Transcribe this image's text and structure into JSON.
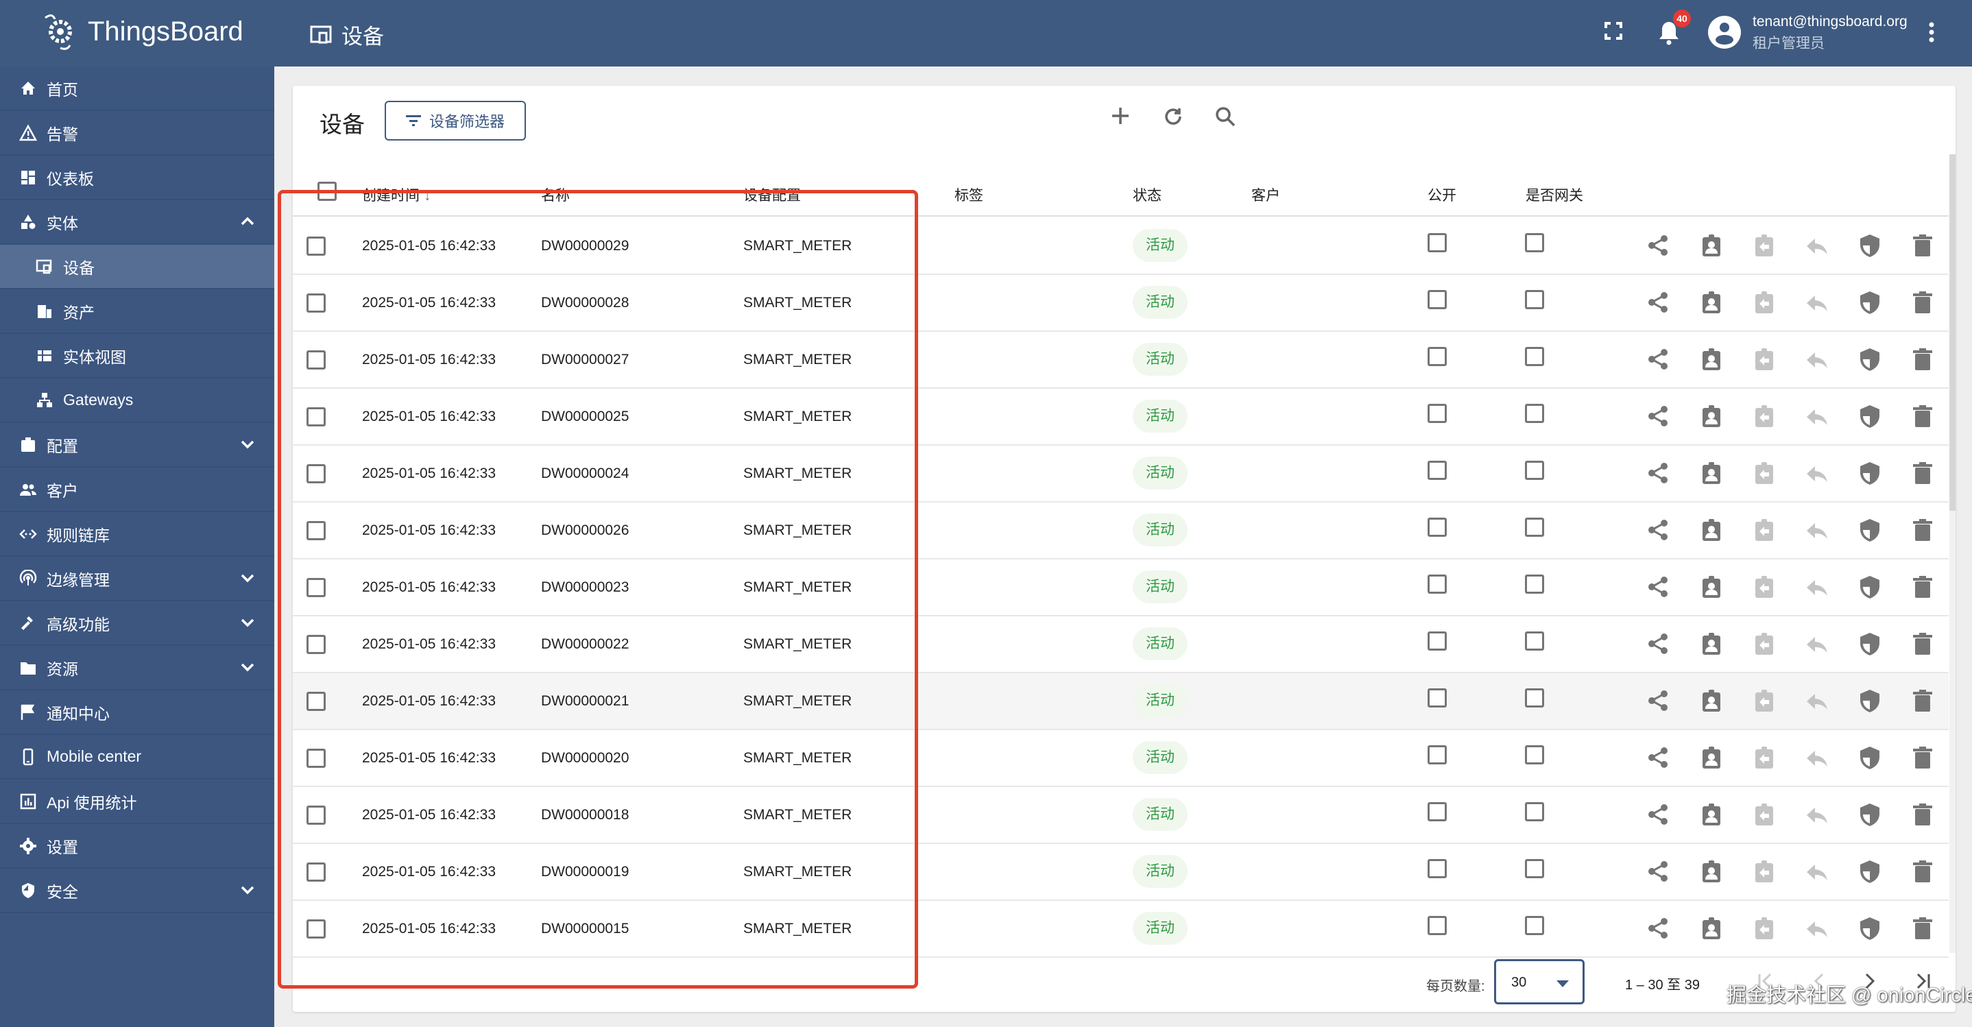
{
  "header": {
    "logo_text": "ThingsBoard",
    "title": "设备",
    "notification_count": "40",
    "user_email": "tenant@thingsboard.org",
    "user_role": "租户管理员"
  },
  "sidebar": {
    "items": [
      {
        "label": "首页",
        "icon": "home-icon",
        "sub": false
      },
      {
        "label": "告警",
        "icon": "warning-icon",
        "sub": false
      },
      {
        "label": "仪表板",
        "icon": "dashboard-icon",
        "sub": false
      },
      {
        "label": "实体",
        "icon": "entity-icon",
        "sub": false,
        "chevron": "up"
      },
      {
        "label": "设备",
        "icon": "device-icon",
        "sub": true,
        "selected": true
      },
      {
        "label": "资产",
        "icon": "asset-icon",
        "sub": true
      },
      {
        "label": "实体视图",
        "icon": "entity-view-icon",
        "sub": true
      },
      {
        "label": "Gateways",
        "icon": "gateway-icon",
        "sub": true
      },
      {
        "label": "配置",
        "icon": "profile-icon",
        "sub": false,
        "chevron": "down"
      },
      {
        "label": "客户",
        "icon": "customers-icon",
        "sub": false
      },
      {
        "label": "规则链库",
        "icon": "rule-chain-icon",
        "sub": false
      },
      {
        "label": "边缘管理",
        "icon": "edge-icon",
        "sub": false,
        "chevron": "down"
      },
      {
        "label": "高级功能",
        "icon": "advanced-icon",
        "sub": false,
        "chevron": "down"
      },
      {
        "label": "资源",
        "icon": "folder-icon",
        "sub": false,
        "chevron": "down"
      },
      {
        "label": "通知中心",
        "icon": "notification-center-icon",
        "sub": false
      },
      {
        "label": "Mobile center",
        "icon": "mobile-icon",
        "sub": false
      },
      {
        "label": "Api 使用统计",
        "icon": "chart-icon",
        "sub": false
      },
      {
        "label": "设置",
        "icon": "settings-icon",
        "sub": false
      },
      {
        "label": "安全",
        "icon": "security-icon",
        "sub": false,
        "chevron": "down"
      }
    ]
  },
  "card": {
    "title": "设备",
    "filter_label": "设备筛选器"
  },
  "table": {
    "columns": [
      "创建时间",
      "名称",
      "设备配置",
      "标签",
      "状态",
      "客户",
      "公开",
      "是否网关"
    ],
    "sort_indicator": "↓",
    "rows": [
      {
        "created": "2025-01-05 16:42:33",
        "name": "DW00000029",
        "profile": "SMART_METER",
        "status": "活动"
      },
      {
        "created": "2025-01-05 16:42:33",
        "name": "DW00000028",
        "profile": "SMART_METER",
        "status": "活动"
      },
      {
        "created": "2025-01-05 16:42:33",
        "name": "DW00000027",
        "profile": "SMART_METER",
        "status": "活动"
      },
      {
        "created": "2025-01-05 16:42:33",
        "name": "DW00000025",
        "profile": "SMART_METER",
        "status": "活动"
      },
      {
        "created": "2025-01-05 16:42:33",
        "name": "DW00000024",
        "profile": "SMART_METER",
        "status": "活动"
      },
      {
        "created": "2025-01-05 16:42:33",
        "name": "DW00000026",
        "profile": "SMART_METER",
        "status": "活动"
      },
      {
        "created": "2025-01-05 16:42:33",
        "name": "DW00000023",
        "profile": "SMART_METER",
        "status": "活动"
      },
      {
        "created": "2025-01-05 16:42:33",
        "name": "DW00000022",
        "profile": "SMART_METER",
        "status": "活动"
      },
      {
        "created": "2025-01-05 16:42:33",
        "name": "DW00000021",
        "profile": "SMART_METER",
        "status": "活动",
        "highlighted": true
      },
      {
        "created": "2025-01-05 16:42:33",
        "name": "DW00000020",
        "profile": "SMART_METER",
        "status": "活动"
      },
      {
        "created": "2025-01-05 16:42:33",
        "name": "DW00000018",
        "profile": "SMART_METER",
        "status": "活动"
      },
      {
        "created": "2025-01-05 16:42:33",
        "name": "DW00000019",
        "profile": "SMART_METER",
        "status": "活动"
      },
      {
        "created": "2025-01-05 16:42:33",
        "name": "DW00000015",
        "profile": "SMART_METER",
        "status": "活动"
      }
    ],
    "row_actions": [
      "share-icon",
      "assign-customer-icon",
      "unassign-customer-icon",
      "reply-icon",
      "credentials-shield-icon",
      "delete-icon"
    ]
  },
  "footer": {
    "page_size_label": "每页数量:",
    "page_size": "30",
    "range": "1 – 30 至 39"
  },
  "watermark": "掘金技术社区 @ onionCircle",
  "colors": {
    "primary": "#3e5a80",
    "status_active": "#2f9a42",
    "highlight_rect": "#e0412c",
    "badge": "#e53935"
  }
}
